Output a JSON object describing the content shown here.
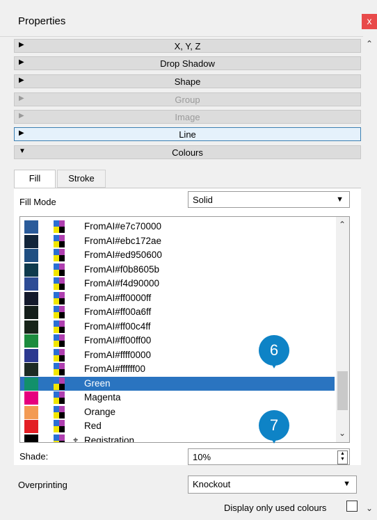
{
  "window": {
    "title": "Properties",
    "close_label": "x"
  },
  "sections": [
    {
      "label": "X, Y, Z",
      "state": "collapsed"
    },
    {
      "label": "Drop Shadow",
      "state": "collapsed"
    },
    {
      "label": "Shape",
      "state": "collapsed"
    },
    {
      "label": "Group",
      "state": "disabled"
    },
    {
      "label": "Image",
      "state": "disabled"
    },
    {
      "label": "Line",
      "state": "active"
    },
    {
      "label": "Colours",
      "state": "expanded"
    }
  ],
  "tabs": {
    "fill": "Fill",
    "stroke": "Stroke"
  },
  "fill_mode": {
    "label": "Fill Mode",
    "value": "Solid"
  },
  "colors": [
    {
      "name": "FromAI#e7c70000",
      "swatch": "#2a5b9a"
    },
    {
      "name": "FromAI#ebc172ae",
      "swatch": "#12253a"
    },
    {
      "name": "FromAI#ed950600",
      "swatch": "#1f4f82"
    },
    {
      "name": "FromAI#f0b8605b",
      "swatch": "#0e3a4d"
    },
    {
      "name": "FromAI#f4d90000",
      "swatch": "#2d4c95"
    },
    {
      "name": "FromAI#ff0000ff",
      "swatch": "#141a2c"
    },
    {
      "name": "FromAI#ff00a6ff",
      "swatch": "#141e1a"
    },
    {
      "name": "FromAI#ff00c4ff",
      "swatch": "#172419"
    },
    {
      "name": "FromAI#ff00ff00",
      "swatch": "#1c8c3e"
    },
    {
      "name": "FromAI#ffff0000",
      "swatch": "#2c3990"
    },
    {
      "name": "FromAI#ffffff00",
      "swatch": "#1d2b24"
    },
    {
      "name": "Green",
      "swatch": "#12906a",
      "selected": true
    },
    {
      "name": "Magenta",
      "swatch": "#e6007e"
    },
    {
      "name": "Orange",
      "swatch": "#f39a53"
    },
    {
      "name": "Red",
      "swatch": "#e31e24"
    },
    {
      "name": "Registration",
      "swatch": "#000000",
      "registration": true
    }
  ],
  "cmyk_colors": {
    "c": "#2a6fd4",
    "m": "#b040b0",
    "y": "#f2e600",
    "k": "#000000"
  },
  "callouts": [
    "6",
    "7"
  ],
  "shade": {
    "label": "Shade:",
    "value": "10%"
  },
  "overprinting": {
    "label": "Overprinting",
    "value": "Knockout"
  },
  "display_used": {
    "label": "Display only used colours",
    "checked": false
  },
  "icons": {
    "collapsed": "triangle-right-icon",
    "expanded": "triangle-down-icon",
    "dropdown": "chevron-down-icon",
    "registration": "registration-mark-icon"
  },
  "accent": "#2a74c0",
  "callout_color": "#0e83c6"
}
